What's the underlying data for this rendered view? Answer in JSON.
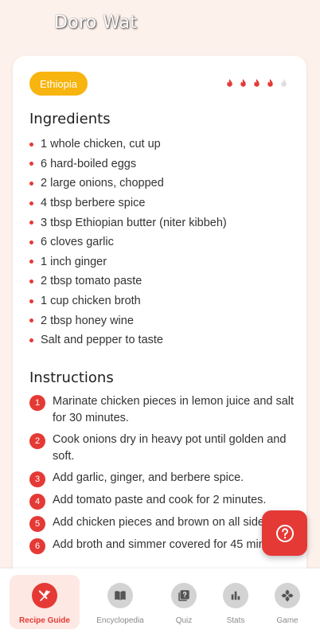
{
  "header": {
    "title": "Doro Wat"
  },
  "recipe": {
    "country": "Ethiopia",
    "spice_level": 4,
    "spice_max": 5,
    "ingredients_title": "Ingredients",
    "ingredients": [
      "1 whole chicken, cut up",
      "6 hard-boiled eggs",
      "2 large onions, chopped",
      "4 tbsp berbere spice",
      "3 tbsp Ethiopian butter (niter kibbeh)",
      "6 cloves garlic",
      "1 inch ginger",
      "2 tbsp tomato paste",
      "1 cup chicken broth",
      "2 tbsp honey wine",
      "Salt and pepper to taste"
    ],
    "instructions_title": "Instructions",
    "steps": [
      {
        "num": "1",
        "text": "Marinate chicken pieces in lemon juice and salt for 30 minutes."
      },
      {
        "num": "2",
        "text": "Cook onions dry in heavy pot until golden and soft."
      },
      {
        "num": "3",
        "text": "Add garlic, ginger, and berbere spice."
      },
      {
        "num": "4",
        "text": "Add tomato paste and cook for 2 minutes."
      },
      {
        "num": "5",
        "text": "Add chicken pieces and brown on all sides."
      },
      {
        "num": "6",
        "text": "Add broth and simmer covered for 45 minutes."
      }
    ]
  },
  "fab": {
    "icon": "help-icon"
  },
  "nav": {
    "items": [
      {
        "label": "Recipe Guide",
        "icon": "utensils-icon",
        "active": true
      },
      {
        "label": "Encyclopedia",
        "icon": "book-icon",
        "active": false
      },
      {
        "label": "Quiz",
        "icon": "quiz-icon",
        "active": false
      },
      {
        "label": "Stats",
        "icon": "bar-chart-icon",
        "active": false
      },
      {
        "label": "Game",
        "icon": "gamepad-icon",
        "active": false
      }
    ]
  },
  "colors": {
    "accent": "#e53935",
    "badge": "#f8b40f",
    "background": "#fdf1ec"
  }
}
